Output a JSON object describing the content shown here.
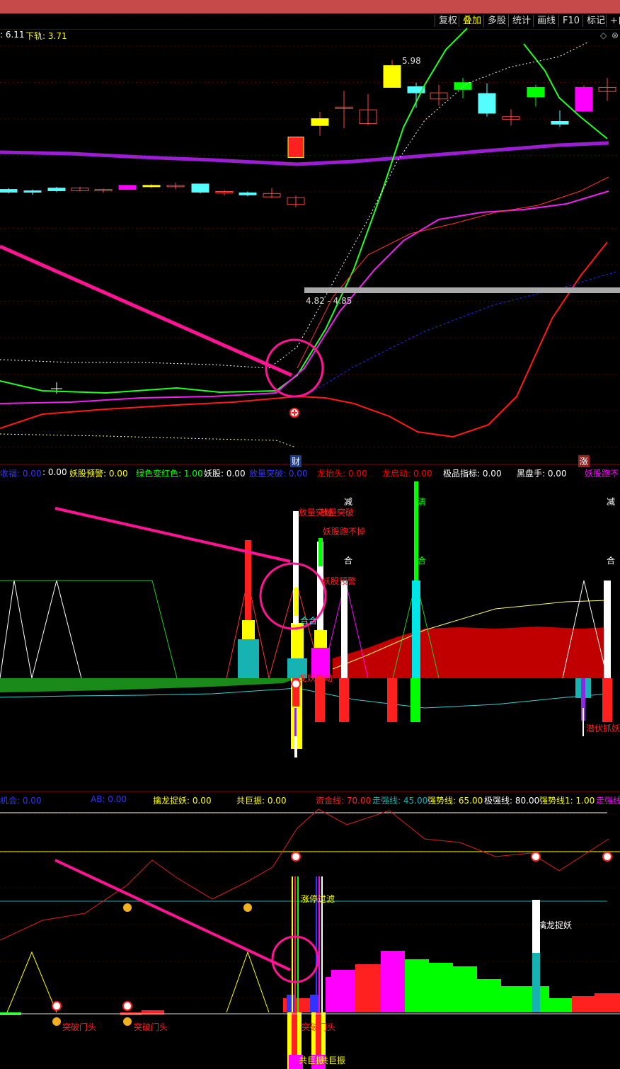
{
  "toolbar": {
    "buttons": [
      "复权",
      "叠加",
      "多股",
      "统计",
      "画线",
      "F10",
      "标记",
      "+自"
    ],
    "active": "叠加"
  },
  "main_panel": {
    "upper_value": "6.11",
    "lower_label": "下轨:",
    "lower_value": "3.71",
    "high_price_label": "5.98",
    "range_label": "4.82 - 4.85",
    "marker_cai": "财",
    "marker_zhang": "涨"
  },
  "indicator1": {
    "headers": [
      {
        "text": "收福: 0.00",
        "color": "#3333ff"
      },
      {
        "text": ": 0.00",
        "color": "#ffffff"
      },
      {
        "text": "妖股预警: 0.00",
        "color": "#ffff00"
      },
      {
        "text": "绿色变红色: 1.00",
        "color": "#00ff00"
      },
      {
        "text": "妖股: 0.00",
        "color": "#ffffff"
      },
      {
        "text": "放量突破: 0.00",
        "color": "#3333ff"
      },
      {
        "text": "龙抬头: 0.00",
        "color": "#ff0000"
      },
      {
        "text": "龙启动: 0.00",
        "color": "#ff0000"
      },
      {
        "text": "极品指标: 0.00",
        "color": "#ffffff"
      },
      {
        "text": "黑盘手: 0.00",
        "color": "#ffffff"
      },
      {
        "text": "妖股跑不",
        "color": "#ff00ff"
      }
    ],
    "annotations": {
      "fangliang": "放量突破",
      "yaogu_pao": "妖股跑不掉",
      "yaogu_yujing": "妖股预警",
      "longyao": "龙妖启动",
      "qianfu": "潜伏抓妖",
      "jian": "减",
      "he": "合",
      "qing": "清",
      "hebi": "合合"
    }
  },
  "indicator2": {
    "headers": [
      {
        "text": "机会: 0.00",
        "color": "#3333ff"
      },
      {
        "text": "AB: 0.00",
        "color": "#3333ff"
      },
      {
        "text": "擒龙捉妖: 0.00",
        "color": "#ffff00"
      },
      {
        "text": "共巨振: 0.00",
        "color": "#ffff00"
      },
      {
        "text": "资金线: 70.00",
        "color": "#ff2020"
      },
      {
        "text": "走强线: 45.00",
        "color": "#20b0b0"
      },
      {
        "text": "强势线: 65.00",
        "color": "#ffff00"
      },
      {
        "text": "极强线: 80.00",
        "color": "#ffffff"
      },
      {
        "text": "强势线1: 1.00",
        "color": "#ffff00"
      },
      {
        "text": "走强线",
        "color": "#ff00ff"
      }
    ],
    "annotations": {
      "tupo": "突破门头",
      "zhangting": "涨停过滤",
      "qinlong": "擒龙捉妖",
      "gongjuzhen": "共巨振"
    }
  },
  "chart_data": {
    "type": "candlestick",
    "candles": [
      {
        "o": 4.08,
        "h": 4.1,
        "l": 4.02,
        "c": 4.04
      },
      {
        "o": 4.05,
        "h": 4.08,
        "l": 4.0,
        "c": 4.06
      },
      {
        "o": 4.06,
        "h": 4.12,
        "l": 4.04,
        "c": 4.1
      },
      {
        "o": 4.1,
        "h": 4.12,
        "l": 4.05,
        "c": 4.06
      },
      {
        "o": 4.06,
        "h": 4.09,
        "l": 4.03,
        "c": 4.08
      },
      {
        "o": 4.08,
        "h": 4.15,
        "l": 4.07,
        "c": 4.14
      },
      {
        "o": 4.14,
        "h": 4.16,
        "l": 4.1,
        "c": 4.12
      },
      {
        "o": 4.12,
        "h": 4.18,
        "l": 4.08,
        "c": 4.14
      },
      {
        "o": 4.16,
        "h": 4.16,
        "l": 4.02,
        "c": 4.04
      },
      {
        "o": 4.05,
        "h": 4.07,
        "l": 3.99,
        "c": 4.04
      },
      {
        "o": 4.03,
        "h": 4.05,
        "l": 3.98,
        "c": 4.0
      },
      {
        "o": 4.02,
        "h": 4.1,
        "l": 3.95,
        "c": 3.97
      },
      {
        "o": 3.96,
        "h": 3.99,
        "l": 3.82,
        "c": 3.86
      },
      {
        "o": 4.18,
        "h": 4.25,
        "l": 4.15,
        "c": 4.24
      },
      {
        "o": 4.38,
        "h": 4.38,
        "l": 4.38,
        "c": 4.38
      },
      {
        "o": 4.85,
        "h": 4.85,
        "l": 4.55,
        "c": 4.55
      },
      {
        "o": 5.12,
        "h": 5.22,
        "l": 4.87,
        "c": 5.02
      },
      {
        "o": 5.28,
        "h": 5.53,
        "l": 4.98,
        "c": 5.29
      },
      {
        "o": 5.25,
        "h": 5.48,
        "l": 5.02,
        "c": 5.05
      },
      {
        "o": 5.58,
        "h": 5.98,
        "l": 5.59,
        "c": 5.9
      },
      {
        "o": 5.59,
        "h": 5.65,
        "l": 5.28,
        "c": 5.5
      },
      {
        "o": 5.41,
        "h": 5.62,
        "l": 5.31,
        "c": 5.5
      },
      {
        "o": 5.55,
        "h": 5.72,
        "l": 5.42,
        "c": 5.65
      },
      {
        "o": 5.49,
        "h": 5.64,
        "l": 5.15,
        "c": 5.2
      },
      {
        "o": 5.11,
        "h": 5.26,
        "l": 5.02,
        "c": 5.15
      },
      {
        "o": 5.44,
        "h": 5.62,
        "l": 5.3,
        "c": 5.58
      },
      {
        "o": 5.04,
        "h": 5.24,
        "l": 5.0,
        "c": 5.08
      },
      {
        "o": 5.58,
        "h": 5.61,
        "l": 5.22,
        "c": 5.23
      },
      {
        "o": 5.52,
        "h": 5.72,
        "l": 5.38,
        "c": 5.58
      }
    ],
    "price_labels": {
      "high": 5.98,
      "range": "4.82 - 4.85"
    },
    "upper_band": 6.11,
    "lower_band": 3.71
  }
}
